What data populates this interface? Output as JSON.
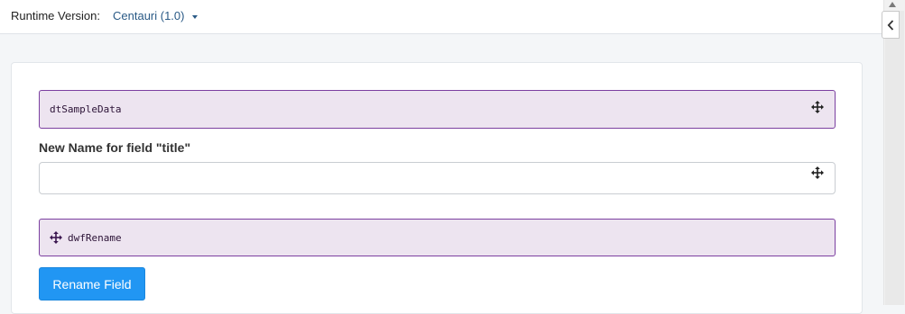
{
  "header": {
    "runtime_label": "Runtime Version:",
    "runtime_value": "Centauri (1.0)"
  },
  "blocks": {
    "top": {
      "label": "dtSampleData",
      "icon": "move-icon"
    },
    "bottom": {
      "label": "dwfRename",
      "icon": "move-icon"
    }
  },
  "form": {
    "field_label": "New Name for field \"title\"",
    "field_value": "",
    "field_placeholder": ""
  },
  "actions": {
    "rename_label": "Rename Field"
  },
  "colors": {
    "accent": "#2196f3",
    "block_bg": "#ede4f0",
    "block_border": "#7b3fa0",
    "link": "#2a5a86"
  }
}
